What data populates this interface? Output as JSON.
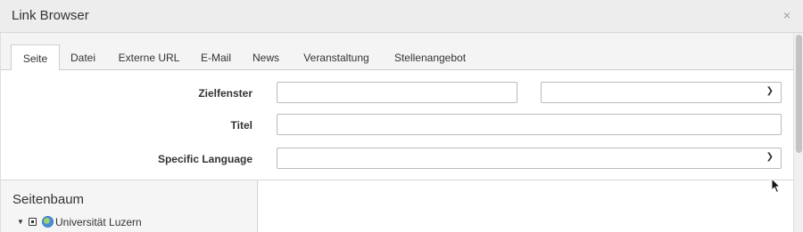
{
  "dialog": {
    "title": "Link Browser",
    "close_glyph": "×"
  },
  "tabs": [
    {
      "label": "Seite",
      "active": true
    },
    {
      "label": "Datei",
      "active": false
    },
    {
      "label": "Externe URL",
      "active": false
    },
    {
      "label": "E-Mail",
      "active": false
    },
    {
      "label": "News",
      "active": false
    },
    {
      "label": "Veranstaltung",
      "active": false
    },
    {
      "label": "Stellenangebot",
      "active": false
    }
  ],
  "form": {
    "zielfenster": {
      "label": "Zielfenster",
      "text_value": "",
      "select_value": ""
    },
    "titel": {
      "label": "Titel",
      "value": ""
    },
    "language": {
      "label": "Specific Language",
      "select_value": ""
    }
  },
  "tree": {
    "title": "Seitenbaum",
    "items": [
      {
        "label": "Universität Luzern",
        "icon": "globe-icon",
        "expanded": true
      }
    ]
  },
  "colors": {
    "header_bg": "#ededed",
    "tree_bg": "#f5f5f5",
    "border": "#cfcfcf"
  }
}
